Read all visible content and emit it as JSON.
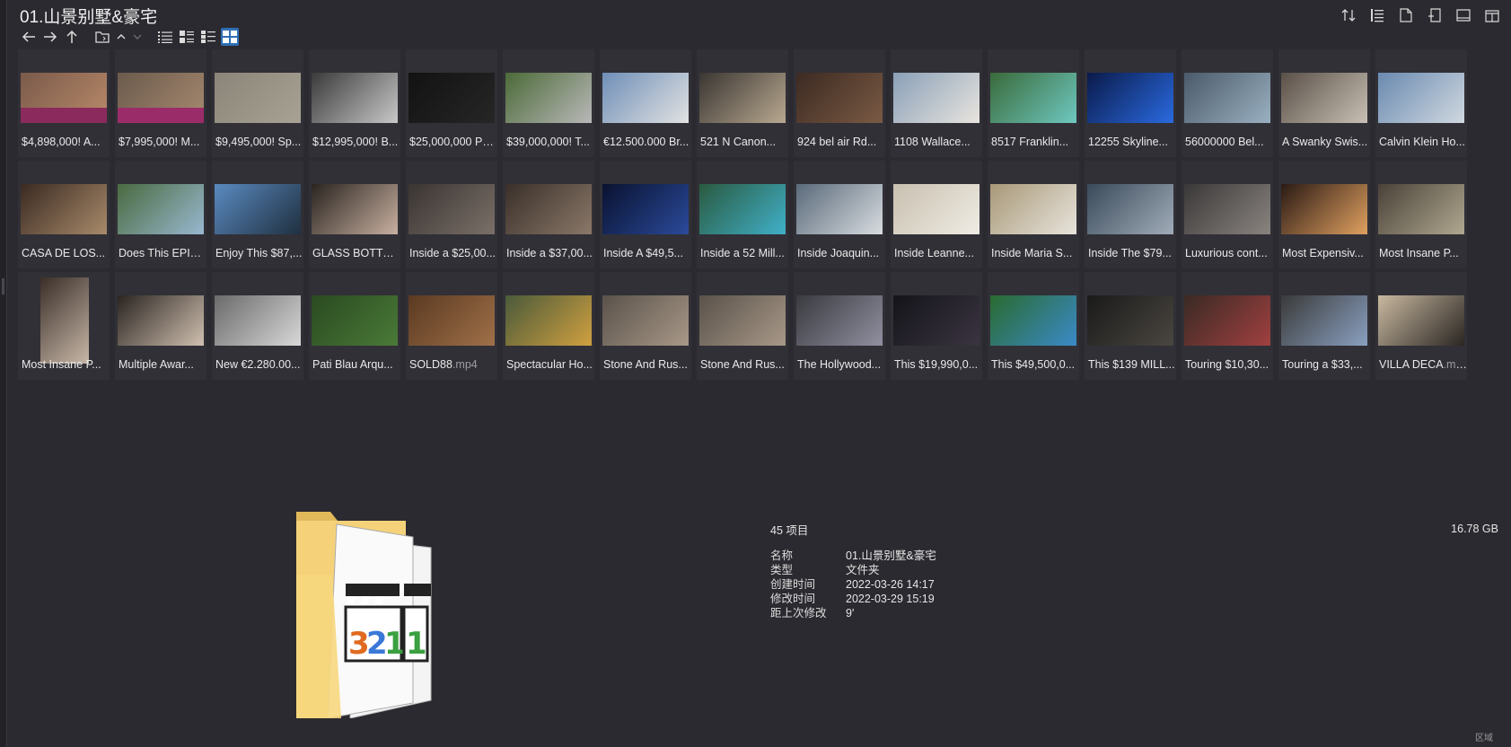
{
  "window": {
    "title": "01.山景别墅&豪宅"
  },
  "nav": {
    "back": "back-arrow-icon",
    "forward": "forward-arrow-icon",
    "up": "up-arrow-icon",
    "folder": "folder-icon",
    "view_list": "list-view-icon",
    "view_details": "details-view-icon",
    "view_tiles": "tiles-view-icon",
    "view_thumbs": "thumbnails-view-icon"
  },
  "accent_color": "#2f6fb5",
  "items": [
    [
      {
        "label": "$4,898,000! A...",
        "colors": [
          "#7a5a4a",
          "#b98a6a"
        ],
        "band": "#8b2a5c"
      },
      {
        "label": "$7,995,000! M...",
        "colors": [
          "#6a5a4c",
          "#a88a70"
        ],
        "band": "#9b2c6a"
      },
      {
        "label": "$9,495,000! Sp...",
        "colors": [
          "#8a8578",
          "#a8a294"
        ]
      },
      {
        "label": "$12,995,000! B...",
        "colors": [
          "#3a3a3a",
          "#c8c8c8"
        ]
      },
      {
        "label": "$25,000,000 Pe...",
        "colors": [
          "#121212",
          "#262626"
        ]
      },
      {
        "label": "$39,000,000! T...",
        "colors": [
          "#4c6a38",
          "#b8b8b8"
        ]
      },
      {
        "label": "€12.500.000 Br...",
        "colors": [
          "#6f8fb8",
          "#e2e2e2"
        ]
      },
      {
        "label": "521 N Canon...",
        "colors": [
          "#3a3632",
          "#b8a890"
        ]
      },
      {
        "label": "924 bel air Rd...",
        "colors": [
          "#3c2a22",
          "#7a5a44"
        ]
      },
      {
        "label": "1108 Wallace...",
        "colors": [
          "#8aa0b8",
          "#e8e4de"
        ]
      },
      {
        "label": "8517 Franklin...",
        "colors": [
          "#3a6a3a",
          "#6ec8c0"
        ]
      },
      {
        "label": "12255 Skyline...",
        "colors": [
          "#0a1a4a",
          "#2a6ae0"
        ]
      },
      {
        "label": "56000000 Bel...",
        "colors": [
          "#4a5a6a",
          "#9ab0c0"
        ]
      },
      {
        "label": "A Swanky Swis...",
        "colors": [
          "#5a5048",
          "#c8c0b4"
        ]
      },
      {
        "label": "Calvin Klein Ho...",
        "colors": [
          "#6a8ab0",
          "#d0d8e0"
        ]
      }
    ],
    [
      {
        "label": "CASA DE LOS...",
        "colors": [
          "#3a2a22",
          "#a88a6a"
        ]
      },
      {
        "label": "Does This EPIC...",
        "colors": [
          "#4a6a40",
          "#98b8d0"
        ]
      },
      {
        "label": "Enjoy This $87,...",
        "colors": [
          "#5a8ac0",
          "#203040"
        ]
      },
      {
        "label": "GLASS BOTTO...",
        "colors": [
          "#2a2420",
          "#c8b0a0"
        ]
      },
      {
        "label": "Inside a $25,00...",
        "colors": [
          "#3a3432",
          "#7a7068"
        ]
      },
      {
        "label": "Inside a $37,00...",
        "colors": [
          "#3a302a",
          "#8a7868"
        ]
      },
      {
        "label": "Inside A $49,5...",
        "colors": [
          "#0a1230",
          "#2a4a9a"
        ]
      },
      {
        "label": "Inside a 52 Mill...",
        "colors": [
          "#2a5a40",
          "#40b0c8"
        ]
      },
      {
        "label": "Inside Joaquin...",
        "colors": [
          "#5a6a7a",
          "#d8dce0"
        ]
      },
      {
        "label": "Inside Leanne...",
        "colors": [
          "#c8c0b0",
          "#f0ece4"
        ]
      },
      {
        "label": "Inside Maria S...",
        "colors": [
          "#a89878",
          "#e8e4dc"
        ]
      },
      {
        "label": "Inside The $79...",
        "colors": [
          "#3a4a5a",
          "#a0acb8"
        ]
      },
      {
        "label": "Luxurious cont...",
        "colors": [
          "#3a3838",
          "#8a8480"
        ]
      },
      {
        "label": "Most Expensiv...",
        "colors": [
          "#2a1a14",
          "#e0a060"
        ]
      },
      {
        "label": "Most Insane P...",
        "colors": [
          "#4a4238",
          "#b0a890"
        ]
      }
    ],
    [
      {
        "label": "Most Insane P...",
        "colors": [
          "#3a2e28",
          "#c8b8a8"
        ],
        "tall": true
      },
      {
        "label": "Multiple Awar...",
        "colors": [
          "#2a2420",
          "#d0c0b0"
        ]
      },
      {
        "label": "New €2.280.00...",
        "colors": [
          "#6a6a6a",
          "#d8d8d8"
        ]
      },
      {
        "label": "Pati Blau  Arqu...",
        "colors": [
          "#2a4a20",
          "#4a7a38"
        ]
      },
      {
        "label": "SOLD88",
        "ext": ".mp4",
        "colors": [
          "#5a3a22",
          "#a07048"
        ]
      },
      {
        "label": "Spectacular Ho...",
        "colors": [
          "#4a5a3a",
          "#d0a040"
        ]
      },
      {
        "label": "Stone And Rus...",
        "colors": [
          "#5a524a",
          "#a89888"
        ]
      },
      {
        "label": "Stone And Rus...",
        "colors": [
          "#5a524a",
          "#a89888"
        ]
      },
      {
        "label": "The Hollywood...",
        "colors": [
          "#3a3a40",
          "#9090a0"
        ]
      },
      {
        "label": "This $19,990,0...",
        "colors": [
          "#14141a",
          "#3a3440"
        ]
      },
      {
        "label": "This $49,500,0...",
        "colors": [
          "#2a6a30",
          "#3a8ac8"
        ]
      },
      {
        "label": "This $139 MILL...",
        "colors": [
          "#1a1a1a",
          "#4a4640"
        ]
      },
      {
        "label": "Touring $10,30...",
        "colors": [
          "#3a2a24",
          "#a04040"
        ]
      },
      {
        "label": "Touring a $33,...",
        "colors": [
          "#3a3a3a",
          "#8aa0c0"
        ]
      },
      {
        "label": "VILLA DECA",
        "ext": ".mp4",
        "colors": [
          "#c8b8a0",
          "#2a2622"
        ]
      }
    ]
  ],
  "selection": {
    "count": "45 项目",
    "size": "16.78 GB",
    "details": [
      {
        "key": "名称",
        "value": "01.山景别墅&豪宅"
      },
      {
        "key": "类型",
        "value": "文件夹"
      },
      {
        "key": "创建时间",
        "value": "2022-03-26  14:17"
      },
      {
        "key": "修改时间",
        "value": "2022-03-29  15:19"
      },
      {
        "key": "距上次修改",
        "value": "9'"
      }
    ]
  },
  "corner_text": "区域"
}
